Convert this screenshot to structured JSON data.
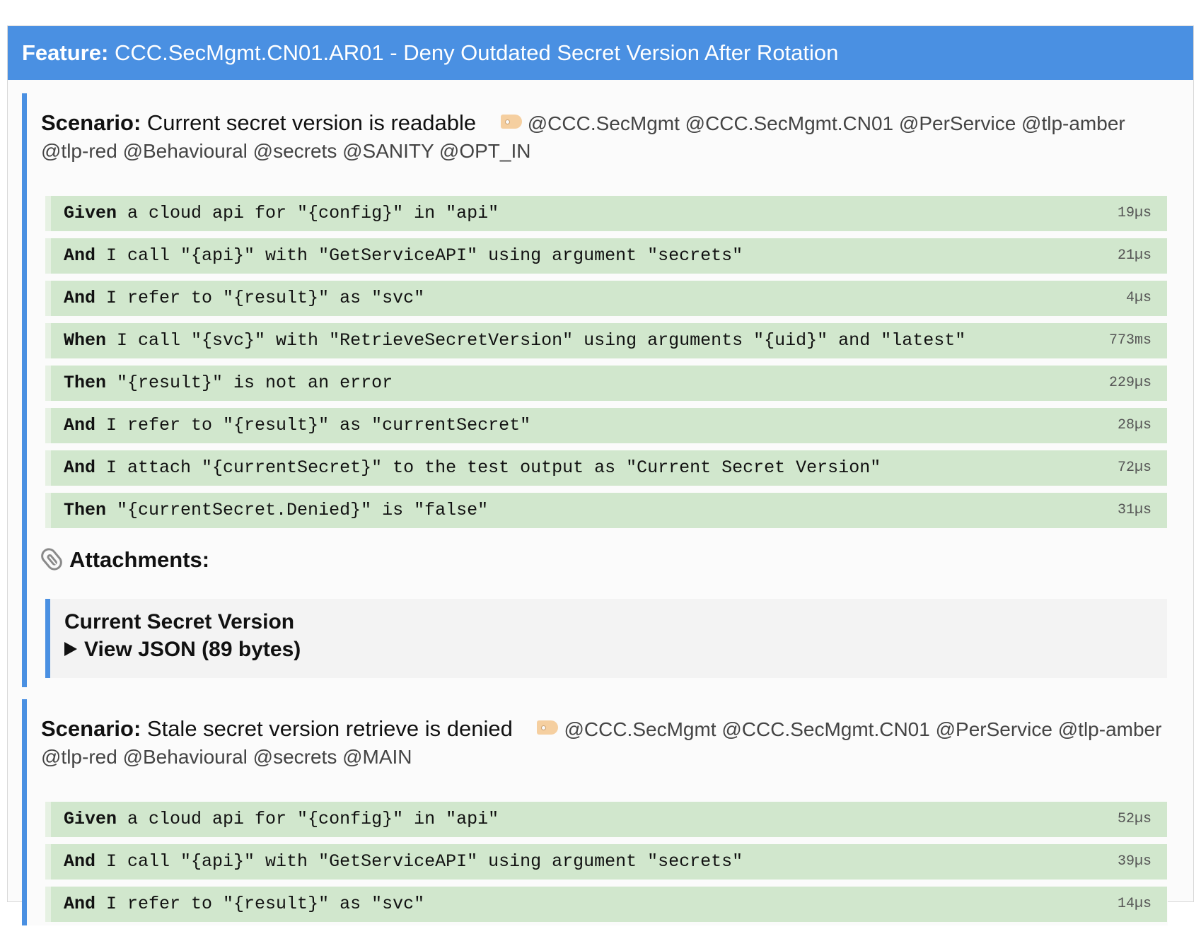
{
  "feature": {
    "keyword": "Feature:",
    "title": "CCC.SecMgmt.CN01.AR01 - Deny Outdated Secret Version After Rotation"
  },
  "colors": {
    "header": "#4a90e2",
    "step_passed": "#d1e7cd",
    "tag_icon": "#f5cfa0"
  },
  "scenarios": [
    {
      "keyword": "Scenario:",
      "title": "Current secret version is readable",
      "tags_line1": "@CCC.SecMgmt @CCC.SecMgmt.CN01 @PerService @tlp-amber",
      "tags_line2": "@tlp-red @Behavioural @secrets @SANITY @OPT_IN",
      "steps": [
        {
          "kw": "Given",
          "text": " a cloud api for \"{config}\" in \"api\"",
          "dur": "19µs"
        },
        {
          "kw": "And",
          "text": " I call \"{api}\" with \"GetServiceAPI\" using argument \"secrets\"",
          "dur": "21µs"
        },
        {
          "kw": "And",
          "text": " I refer to \"{result}\" as \"svc\"",
          "dur": "4µs"
        },
        {
          "kw": "When",
          "text": " I call \"{svc}\" with \"RetrieveSecretVersion\" using arguments \"{uid}\" and \"latest\"",
          "dur": "773ms"
        },
        {
          "kw": "Then",
          "text": " \"{result}\" is not an error",
          "dur": "229µs"
        },
        {
          "kw": "And",
          "text": " I refer to \"{result}\" as \"currentSecret\"",
          "dur": "28µs"
        },
        {
          "kw": "And",
          "text": " I attach \"{currentSecret}\" to the test output as \"Current Secret Version\"",
          "dur": "72µs"
        },
        {
          "kw": "Then",
          "text": " \"{currentSecret.Denied}\" is \"false\"",
          "dur": "31µs"
        }
      ],
      "attachments_label": "Attachments:",
      "attachment": {
        "name": "Current Secret Version",
        "view": "View JSON (89 bytes)"
      }
    },
    {
      "keyword": "Scenario:",
      "title": "Stale secret version retrieve is denied",
      "tags_line1": "@CCC.SecMgmt @CCC.SecMgmt.CN01 @PerService @tlp-amber",
      "tags_line2": "@tlp-red @Behavioural @secrets @MAIN",
      "steps": [
        {
          "kw": "Given",
          "text": " a cloud api for \"{config}\" in \"api\"",
          "dur": "52µs"
        },
        {
          "kw": "And",
          "text": " I call \"{api}\" with \"GetServiceAPI\" using argument \"secrets\"",
          "dur": "39µs"
        },
        {
          "kw": "And",
          "text": " I refer to \"{result}\" as \"svc\"",
          "dur": "14µs"
        }
      ]
    }
  ]
}
